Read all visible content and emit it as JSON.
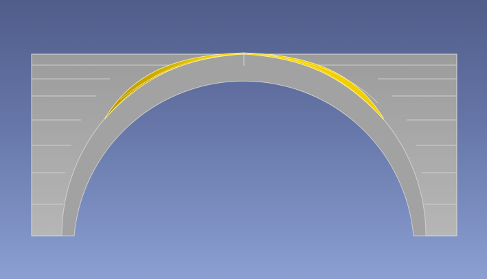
{
  "viewport": {
    "background_top": "#505d8b",
    "background_bottom": "#8b9fd2"
  },
  "model": {
    "body_color": "#a9a9a9",
    "body_light": "#bdbdbd",
    "edge_color": "#e6e6e6",
    "ring_color": "#9a9a9a",
    "selection_color": "#f5d400",
    "selection_dark": "#b89500",
    "courses": 7
  }
}
